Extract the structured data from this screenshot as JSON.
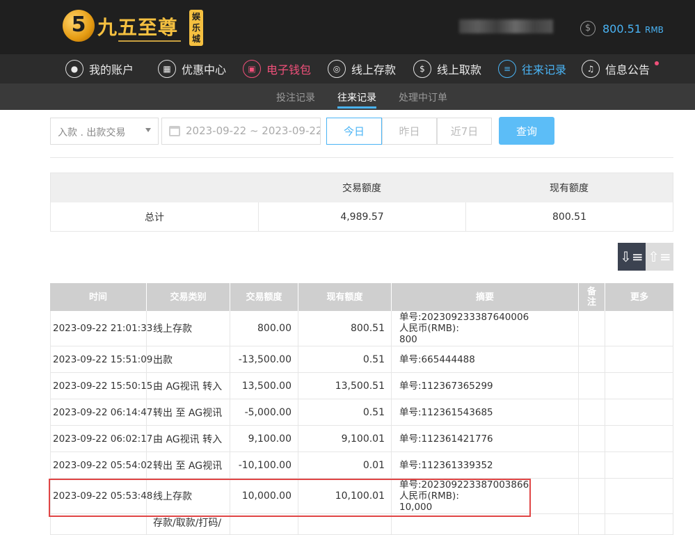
{
  "logo": {
    "number": "5",
    "name": "九五至尊",
    "badge": "娱乐城"
  },
  "account": {
    "balance": "800.51",
    "currency": "RMB"
  },
  "nav": [
    {
      "label": "我的账户",
      "icon": "user-icon"
    },
    {
      "label": "优惠中心",
      "icon": "gift-icon"
    },
    {
      "label": "电子钱包",
      "icon": "wallet-icon"
    },
    {
      "label": "线上存款",
      "icon": "deposit-icon"
    },
    {
      "label": "线上取款",
      "icon": "withdraw-icon"
    },
    {
      "label": "往来记录",
      "icon": "records-icon"
    },
    {
      "label": "信息公告",
      "icon": "bell-icon"
    }
  ],
  "subtabs": [
    "投注记录",
    "往来记录",
    "处理中订单"
  ],
  "filters": {
    "type": "入款 . 出款交易",
    "date_range": "2023-09-22 ~ 2023-09-22",
    "ranges": [
      "今日",
      "昨日",
      "近7日"
    ],
    "query": "查询"
  },
  "summary": {
    "headers": [
      "",
      "交易额度",
      "现有额度"
    ],
    "row": [
      "总计",
      "4,989.57",
      "800.51"
    ]
  },
  "table": {
    "headers": [
      "时间",
      "交易类别",
      "交易额度",
      "现有额度",
      "摘要",
      "备注",
      "更多"
    ],
    "rows": [
      {
        "time": "2023-09-22 21:01:33",
        "type": "线上存款",
        "amount": "800.00",
        "balance": "800.51",
        "summary": [
          "单号:202309233387640006",
          "人民币(RMB):",
          "800"
        ]
      },
      {
        "time": "2023-09-22 15:51:09",
        "type": "出款",
        "amount": "-13,500.00",
        "balance": "0.51",
        "summary": [
          "单号:665444488"
        ]
      },
      {
        "time": "2023-09-22 15:50:15",
        "type": "由 AG视讯 转入",
        "amount": "13,500.00",
        "balance": "13,500.51",
        "summary": [
          "单号:112367365299"
        ]
      },
      {
        "time": "2023-09-22 06:14:47",
        "type": "转出 至 AG视讯",
        "amount": "-5,000.00",
        "balance": "0.51",
        "summary": [
          "单号:112361543685"
        ]
      },
      {
        "time": "2023-09-22 06:02:17",
        "type": "由 AG视讯 转入",
        "amount": "9,100.00",
        "balance": "9,100.01",
        "summary": [
          "单号:112361421776"
        ]
      },
      {
        "time": "2023-09-22 05:54:02",
        "type": "转出 至 AG视讯",
        "amount": "-10,100.00",
        "balance": "0.01",
        "summary": [
          "单号:112361339352"
        ]
      },
      {
        "time": "2023-09-22 05:53:48",
        "type": "线上存款",
        "amount": "10,000.00",
        "balance": "10,100.01",
        "summary": [
          "单号:202309223387003866",
          "人民币(RMB):",
          "10,000"
        ]
      },
      {
        "time": "",
        "type": "存款/取款/打码/",
        "amount": "",
        "balance": "",
        "summary": []
      }
    ]
  }
}
